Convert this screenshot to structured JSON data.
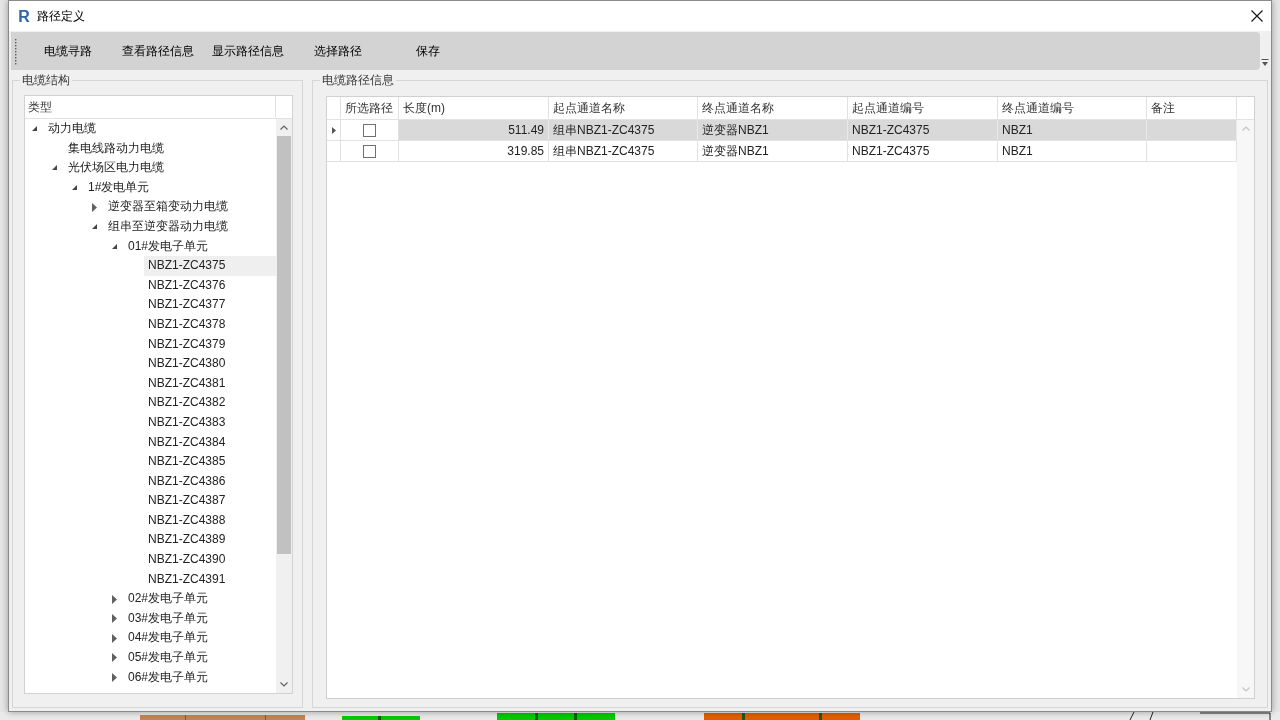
{
  "window": {
    "logo": "R",
    "title": "路径定义"
  },
  "toolbar": {
    "buttons": [
      "电缆寻路",
      "查看路径信息",
      "显示路径信息",
      "选择路径",
      "保存"
    ]
  },
  "cable_structure": {
    "title": "电缆结构",
    "header": "类型",
    "items": [
      {
        "label": "动力电缆",
        "expanded": true,
        "selected": false,
        "children": [
          {
            "kind": "leaf",
            "label": "集电线路动力电缆",
            "selected": false
          },
          {
            "kind": "branch",
            "label": "光伏场区电力电缆",
            "expanded": true,
            "selected": false,
            "children": [
              {
                "label": "1#发电单元",
                "expanded": true,
                "selected": false,
                "children": [
                  {
                    "label": "逆变器至箱变动力电缆",
                    "expanded": false,
                    "selected": false
                  },
                  {
                    "label": "组串至逆变器动力电缆",
                    "expanded": true,
                    "selected": false,
                    "children": [
                      {
                        "label": "01#发电子单元",
                        "expanded": true,
                        "selected": false,
                        "children": [
                          {
                            "label": "NBZ1-ZC4375",
                            "selected": true
                          },
                          {
                            "label": "NBZ1-ZC4376",
                            "selected": false
                          },
                          {
                            "label": "NBZ1-ZC4377",
                            "selected": false
                          },
                          {
                            "label": "NBZ1-ZC4378",
                            "selected": false
                          },
                          {
                            "label": "NBZ1-ZC4379",
                            "selected": false
                          },
                          {
                            "label": "NBZ1-ZC4380",
                            "selected": false
                          },
                          {
                            "label": "NBZ1-ZC4381",
                            "selected": false
                          },
                          {
                            "label": "NBZ1-ZC4382",
                            "selected": false
                          },
                          {
                            "label": "NBZ1-ZC4383",
                            "selected": false
                          },
                          {
                            "label": "NBZ1-ZC4384",
                            "selected": false
                          },
                          {
                            "label": "NBZ1-ZC4385",
                            "selected": false
                          },
                          {
                            "label": "NBZ1-ZC4386",
                            "selected": false
                          },
                          {
                            "label": "NBZ1-ZC4387",
                            "selected": false
                          },
                          {
                            "label": "NBZ1-ZC4388",
                            "selected": false
                          },
                          {
                            "label": "NBZ1-ZC4389",
                            "selected": false
                          },
                          {
                            "label": "NBZ1-ZC4390",
                            "selected": false
                          },
                          {
                            "label": "NBZ1-ZC4391",
                            "selected": false
                          }
                        ]
                      },
                      {
                        "label": "02#发电子单元",
                        "expanded": false,
                        "selected": false
                      },
                      {
                        "label": "03#发电子单元",
                        "expanded": false,
                        "selected": false
                      },
                      {
                        "label": "04#发电子单元",
                        "expanded": false,
                        "selected": false
                      },
                      {
                        "label": "05#发电子单元",
                        "expanded": false,
                        "selected": false
                      },
                      {
                        "label": "06#发电子单元",
                        "expanded": false,
                        "selected": false
                      }
                    ]
                  }
                ]
              }
            ]
          }
        ]
      }
    ]
  },
  "path_info": {
    "title": "电缆路径信息",
    "checkbox_column": "所选路径",
    "columns": [
      "长度(m)",
      "起点通道名称",
      "终点通道名称",
      "起点通道编号",
      "终点通道编号",
      "备注"
    ],
    "rows": [
      {
        "selected": true,
        "checked": false,
        "cells": [
          "511.49",
          "组串NBZ1-ZC4375",
          "逆变器NBZ1",
          "NBZ1-ZC4375",
          "NBZ1"
        ]
      },
      {
        "selected": false,
        "checked": false,
        "cells": [
          "319.85",
          "组串NBZ1-ZC4375",
          "逆变器NBZ1",
          "NBZ1-ZC4375",
          "NBZ1"
        ]
      }
    ]
  }
}
